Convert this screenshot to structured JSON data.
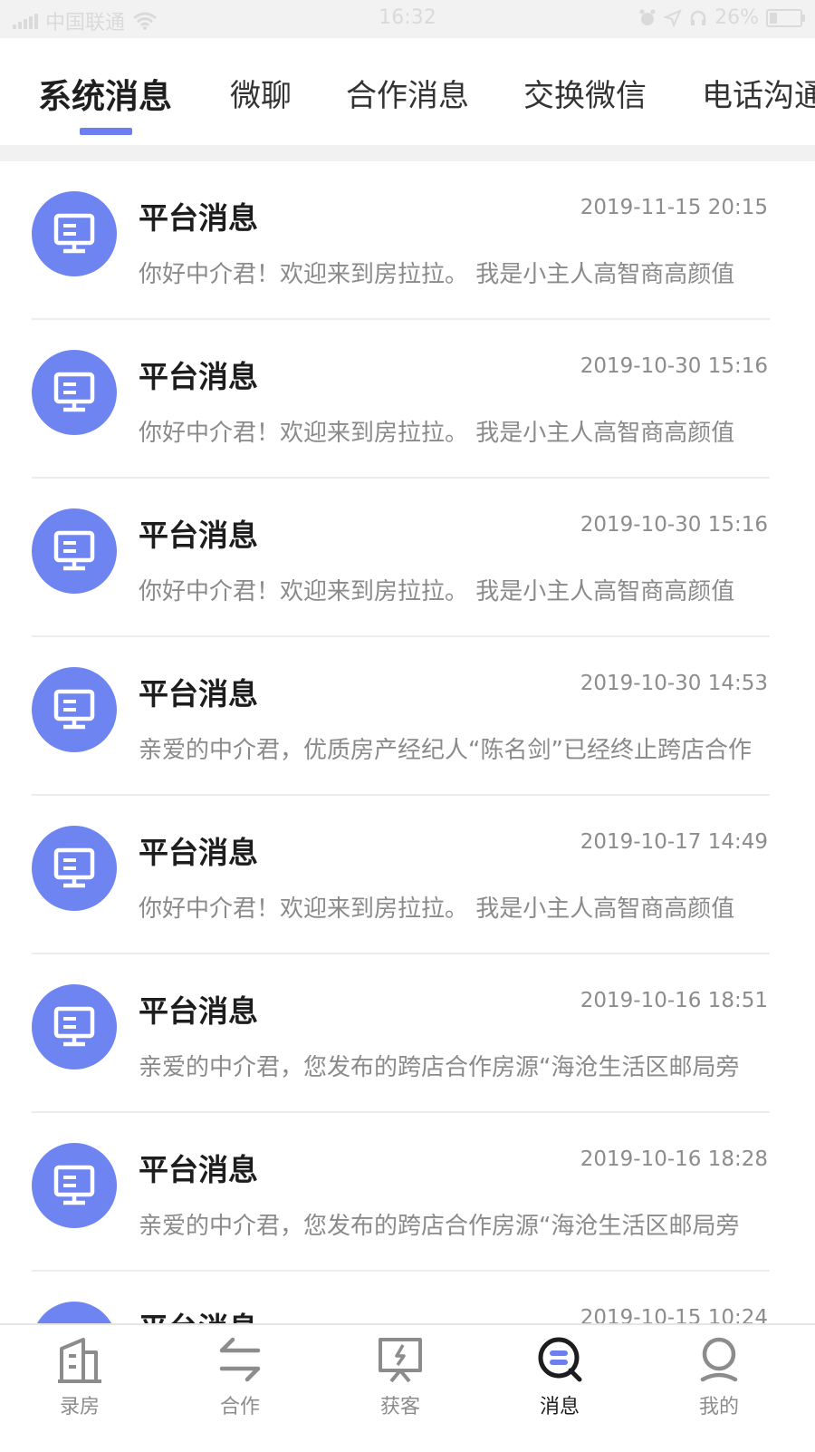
{
  "status_bar": {
    "carrier": "中国联通",
    "time": "16:32",
    "battery": "26%",
    "battery_level": 0.26
  },
  "tabs": [
    {
      "label": "系统消息",
      "active": true
    },
    {
      "label": "微聊",
      "active": false
    },
    {
      "label": "合作消息",
      "active": false
    },
    {
      "label": "交换微信",
      "active": false
    },
    {
      "label": "电话沟通",
      "active": false
    }
  ],
  "messages": [
    {
      "title": "平台消息",
      "time": "2019-11-15 20:15",
      "preview": "你好中介君！欢迎来到房拉拉。 我是小主人高智商高颜值"
    },
    {
      "title": "平台消息",
      "time": "2019-10-30 15:16",
      "preview": "你好中介君！欢迎来到房拉拉。 我是小主人高智商高颜值"
    },
    {
      "title": "平台消息",
      "time": "2019-10-30 15:16",
      "preview": "你好中介君！欢迎来到房拉拉。 我是小主人高智商高颜值"
    },
    {
      "title": "平台消息",
      "time": "2019-10-30 14:53",
      "preview": "亲爱的中介君，优质房产经纪人“陈名剑”已经终止跨店合作"
    },
    {
      "title": "平台消息",
      "time": "2019-10-17 14:49",
      "preview": "你好中介君！欢迎来到房拉拉。 我是小主人高智商高颜值"
    },
    {
      "title": "平台消息",
      "time": "2019-10-16 18:51",
      "preview": "亲爱的中介君，您发布的跨店合作房源“海沧生活区邮局旁"
    },
    {
      "title": "平台消息",
      "time": "2019-10-16 18:28",
      "preview": "亲爱的中介君，您发布的跨店合作房源“海沧生活区邮局旁"
    },
    {
      "title": "平台消息",
      "time": "2019-10-15 10:24",
      "preview": ""
    }
  ],
  "bottom_nav": [
    {
      "label": "录房",
      "icon": "building-icon",
      "active": false
    },
    {
      "label": "合作",
      "icon": "swap-arrows-icon",
      "active": false
    },
    {
      "label": "获客",
      "icon": "lightning-board-icon",
      "active": false
    },
    {
      "label": "消息",
      "icon": "chat-bubble-icon",
      "active": true
    },
    {
      "label": "我的",
      "icon": "person-icon",
      "active": false
    }
  ],
  "colors": {
    "accent": "#6b7ff0",
    "avatar": "#6e84f0",
    "title_text": "#1d1d1d",
    "secondary_text": "#8a8a8a"
  }
}
